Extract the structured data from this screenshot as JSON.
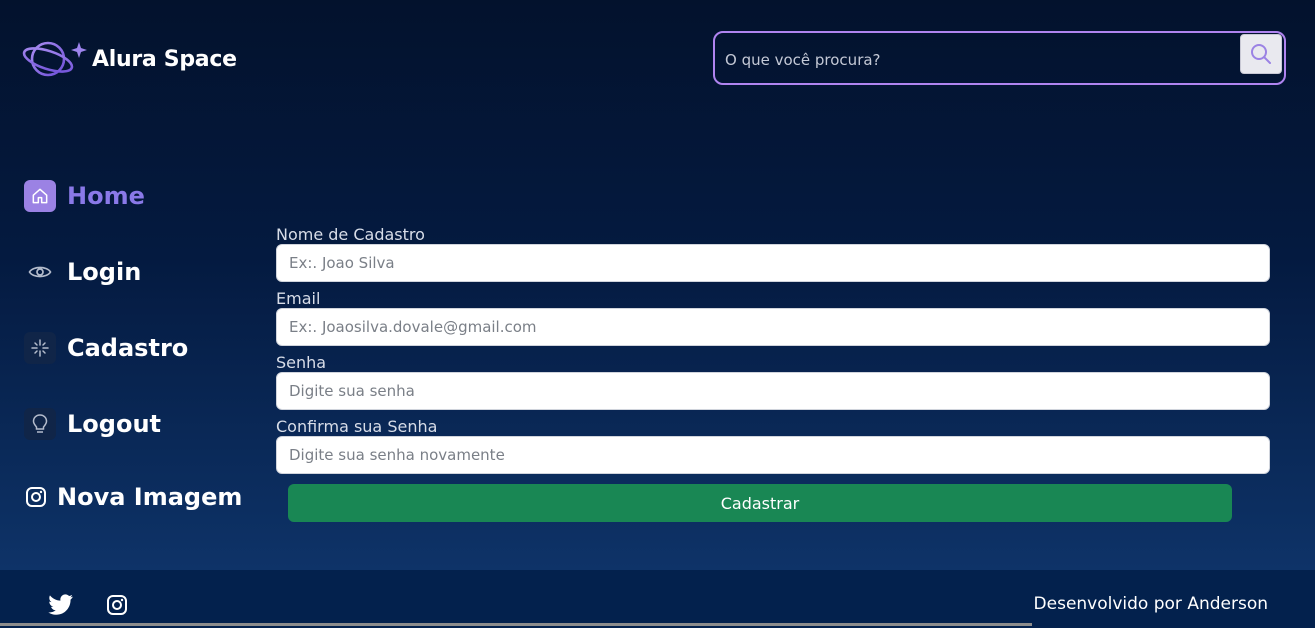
{
  "header": {
    "logo_text": "Alura Space",
    "search": {
      "placeholder": "O que você procura?",
      "icon": "search-icon"
    }
  },
  "sidebar": {
    "items": [
      {
        "label": "Home",
        "icon": "home-icon",
        "active": true
      },
      {
        "label": "Login",
        "icon": "eye-icon"
      },
      {
        "label": "Cadastro",
        "icon": "sparkle-icon"
      },
      {
        "label": "Logout",
        "icon": "lightbulb-icon"
      },
      {
        "label": "Nova Imagem",
        "icon": "instagram-icon"
      }
    ]
  },
  "form": {
    "fields": [
      {
        "label": "Nome de Cadastro",
        "placeholder": "Ex:. Joao Silva"
      },
      {
        "label": "Email",
        "placeholder": "Ex:. Joaosilva.dovale@gmail.com"
      },
      {
        "label": "Senha",
        "placeholder": "Digite sua senha"
      },
      {
        "label": "Confirma sua Senha",
        "placeholder": "Digite sua senha novamente"
      }
    ],
    "submit_label": "Cadastrar"
  },
  "footer": {
    "social": [
      "twitter-icon",
      "instagram-icon"
    ],
    "credit": "Desenvolvido por Anderson"
  },
  "colors": {
    "accent": "#8a79e8",
    "search_border": "#b084f0",
    "submit": "#198754",
    "footer_bg": "#03214d"
  }
}
